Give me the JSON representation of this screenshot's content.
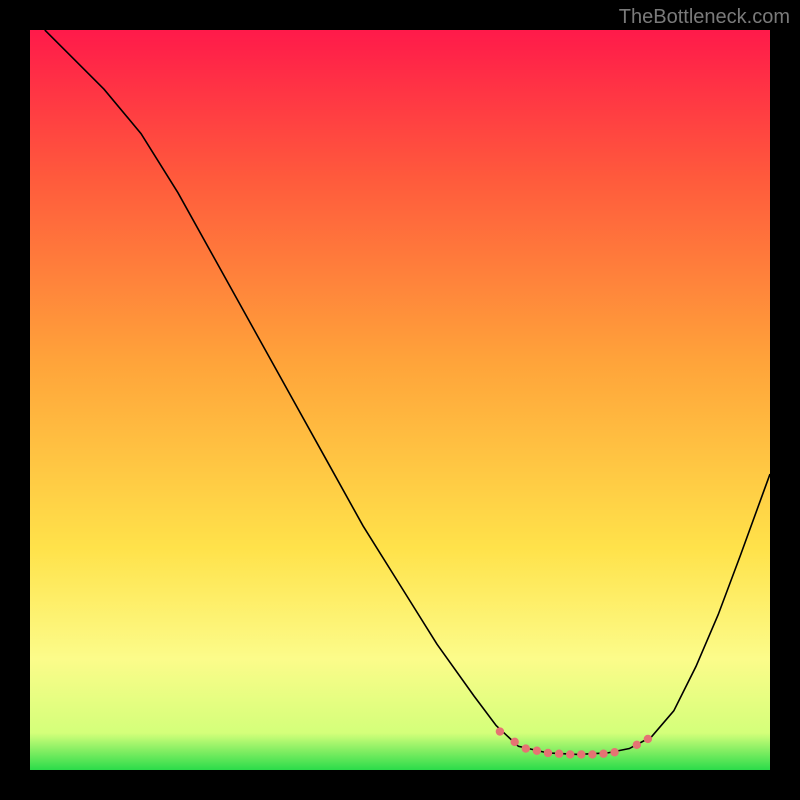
{
  "watermark": "TheBottleneck.com",
  "chart_data": {
    "type": "line",
    "title": "",
    "xlabel": "",
    "ylabel": "",
    "xlim": [
      0,
      100
    ],
    "ylim": [
      0,
      100
    ],
    "gradient_stops": [
      {
        "offset": 0,
        "color": "#ff1a4a"
      },
      {
        "offset": 20,
        "color": "#ff5a3c"
      },
      {
        "offset": 45,
        "color": "#ffa43a"
      },
      {
        "offset": 70,
        "color": "#ffe24a"
      },
      {
        "offset": 85,
        "color": "#fcfc8a"
      },
      {
        "offset": 95,
        "color": "#d4ff7a"
      },
      {
        "offset": 100,
        "color": "#2bdc4a"
      }
    ],
    "series": [
      {
        "name": "curve",
        "color": "#000000",
        "width": 1.6,
        "points": [
          {
            "x": 2,
            "y": 100
          },
          {
            "x": 5,
            "y": 97
          },
          {
            "x": 10,
            "y": 92
          },
          {
            "x": 15,
            "y": 86
          },
          {
            "x": 20,
            "y": 78
          },
          {
            "x": 25,
            "y": 69
          },
          {
            "x": 30,
            "y": 60
          },
          {
            "x": 35,
            "y": 51
          },
          {
            "x": 40,
            "y": 42
          },
          {
            "x": 45,
            "y": 33
          },
          {
            "x": 50,
            "y": 25
          },
          {
            "x": 55,
            "y": 17
          },
          {
            "x": 60,
            "y": 10
          },
          {
            "x": 63,
            "y": 6
          },
          {
            "x": 66,
            "y": 3.2
          },
          {
            "x": 70,
            "y": 2.3
          },
          {
            "x": 74,
            "y": 2.1
          },
          {
            "x": 78,
            "y": 2.3
          },
          {
            "x": 81,
            "y": 2.9
          },
          {
            "x": 84,
            "y": 4.5
          },
          {
            "x": 87,
            "y": 8
          },
          {
            "x": 90,
            "y": 14
          },
          {
            "x": 93,
            "y": 21
          },
          {
            "x": 96,
            "y": 29
          },
          {
            "x": 100,
            "y": 40
          }
        ]
      }
    ],
    "highlight": {
      "color": "#e57373",
      "radius": 4.2,
      "points": [
        {
          "x": 63.5,
          "y": 5.2
        },
        {
          "x": 65.5,
          "y": 3.8
        },
        {
          "x": 67.0,
          "y": 2.9
        },
        {
          "x": 68.5,
          "y": 2.6
        },
        {
          "x": 70.0,
          "y": 2.3
        },
        {
          "x": 71.5,
          "y": 2.2
        },
        {
          "x": 73.0,
          "y": 2.1
        },
        {
          "x": 74.5,
          "y": 2.1
        },
        {
          "x": 76.0,
          "y": 2.1
        },
        {
          "x": 77.5,
          "y": 2.2
        },
        {
          "x": 79.0,
          "y": 2.4
        },
        {
          "x": 82.0,
          "y": 3.4
        },
        {
          "x": 83.5,
          "y": 4.2
        }
      ]
    }
  }
}
